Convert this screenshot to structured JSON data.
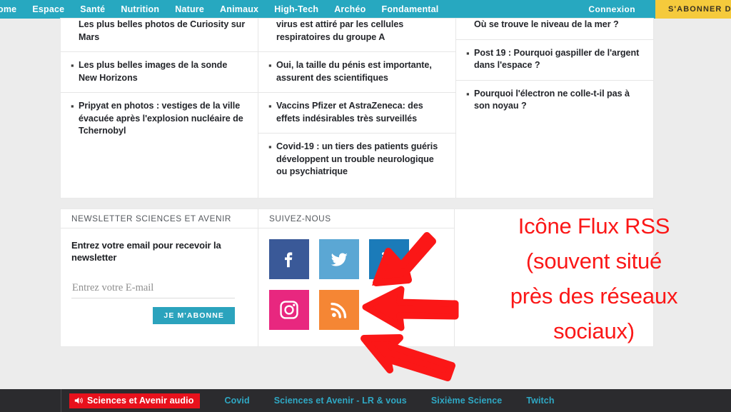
{
  "topnav": {
    "items": [
      {
        "label": "ome",
        "name": "nav-home"
      },
      {
        "label": "Espace",
        "name": "nav-espace"
      },
      {
        "label": "Santé",
        "name": "nav-sante"
      },
      {
        "label": "Nutrition",
        "name": "nav-nutrition"
      },
      {
        "label": "Nature",
        "name": "nav-nature"
      },
      {
        "label": "Animaux",
        "name": "nav-animaux"
      },
      {
        "label": "High-Tech",
        "name": "nav-high-tech"
      },
      {
        "label": "Archéo",
        "name": "nav-archeo"
      },
      {
        "label": "Fondamental",
        "name": "nav-fondamental"
      }
    ],
    "login_label": "Connexion",
    "subscribe_label": "S'ABONNER D",
    "bg_color": "#27a8c0",
    "subscribe_color": "#f5ca3c"
  },
  "articles": {
    "columns": [
      {
        "name": "column-espace",
        "items": [
          {
            "title": "Les plus belles photos de Curiosity sur Mars",
            "clipped": true
          },
          {
            "title": "Les plus belles images de la sonde New Horizons",
            "clipped": false
          },
          {
            "title": "Pripyat en photos : vestiges de la ville évacuée après l'explosion nucléaire de Tchernobyl",
            "clipped": false
          }
        ]
      },
      {
        "name": "column-sante",
        "items": [
          {
            "title": "virus est attiré par les cellules respiratoires du groupe A",
            "clipped": true
          },
          {
            "title": "Oui, la taille du pénis est importante, assurent des scientifiques",
            "clipped": false
          },
          {
            "title": "Vaccins Pfizer et AstraZeneca: des effets indésirables très surveillés",
            "clipped": false
          },
          {
            "title": "Covid-19 : un tiers des patients guéris développent un trouble neurologique ou psychiatrique",
            "clipped": false
          }
        ]
      },
      {
        "name": "column-fondamental",
        "items": [
          {
            "title": "Où se trouve le niveau de la mer ?",
            "clipped": true
          },
          {
            "title": "Post 19 : Pourquoi gaspiller de l'argent dans l'espace ?",
            "clipped": false
          },
          {
            "title": "Pourquoi l'électron ne colle-t-il pas à son noyau ?",
            "clipped": false
          }
        ]
      }
    ]
  },
  "newsletter": {
    "header": "NEWSLETTER SCIENCES ET AVENIR",
    "title": "Entrez votre email pour recevoir la newsletter",
    "input_placeholder": "Entrez votre E-mail",
    "input_value": "",
    "submit_label": "JE M'ABONNE",
    "submit_color": "#2ba3bd"
  },
  "social": {
    "header": "SUIVEZ-NOUS",
    "icons": [
      {
        "name": "facebook-icon",
        "label": "Facebook",
        "color": "#3a5998"
      },
      {
        "name": "twitter-icon",
        "label": "Twitter",
        "color": "#5ba7d4"
      },
      {
        "name": "linkedin-icon",
        "label": "LinkedIn",
        "color": "#1b7bb9"
      },
      {
        "name": "instagram-icon",
        "label": "Instagram",
        "color": "#e8277f"
      },
      {
        "name": "rss-icon",
        "label": "RSS",
        "color": "#f58634"
      }
    ]
  },
  "annotation": {
    "lines": [
      "Icône Flux RSS",
      "(souvent situé",
      "près des réseaux",
      "sociaux)"
    ],
    "color": "#fb1717",
    "arrow_count": 3,
    "arrow_target": "rss-icon"
  },
  "footer": {
    "audio_badge": "Sciences et Avenir audio",
    "audio_badge_color": "#e8111c",
    "links": [
      "Covid",
      "Sciences et Avenir - LR & vous",
      "Sixième Science",
      "Twitch"
    ],
    "link_color": "#2fa8c4",
    "bg_color": "#2b2b2e"
  }
}
